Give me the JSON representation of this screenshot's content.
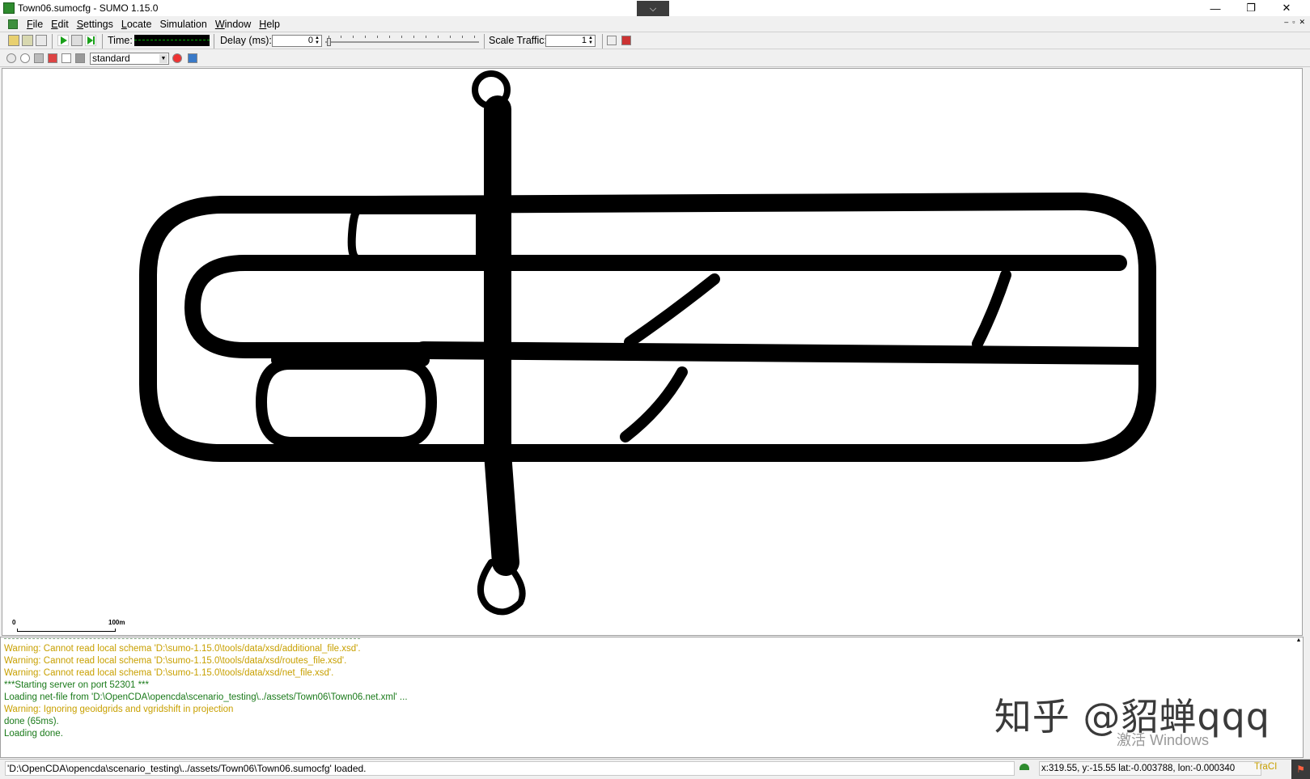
{
  "window": {
    "title": "Town06.sumocfg - SUMO 1.15.0",
    "collapse_glyph": "⌵",
    "minimize_glyph": "—",
    "restore_glyph": "❐",
    "close_glyph": "✕"
  },
  "menu": {
    "items": [
      {
        "u": "F",
        "rest": "ile"
      },
      {
        "u": "E",
        "rest": "dit"
      },
      {
        "u": "S",
        "rest": "ettings"
      },
      {
        "u": "L",
        "rest": "ocate"
      },
      {
        "u": "S",
        "rest": "imulation"
      },
      {
        "u": "W",
        "rest": "indow"
      },
      {
        "u": "H",
        "rest": "elp"
      }
    ],
    "mdi_buttons": [
      "–",
      "▫",
      "✕"
    ]
  },
  "toolbar": {
    "time_label": "Time:",
    "delay_label": "Delay (ms):",
    "delay_value": "0",
    "scale_traffic_label": "Scale Traffic:",
    "scale_traffic_value": "1",
    "delay_slider_value": 0
  },
  "view": {
    "scheme": "standard"
  },
  "canvas": {
    "scale_zero": "0",
    "scale_label": "100m"
  },
  "log": {
    "lines": [
      {
        "type": "warning",
        "text": "Warning: Cannot read local schema 'D:\\sumo-1.15.0\\tools/data/xsd/additional_file.xsd'."
      },
      {
        "type": "warning",
        "text": "Warning: Cannot read local schema 'D:\\sumo-1.15.0\\tools/data/xsd/routes_file.xsd'."
      },
      {
        "type": "warning",
        "text": "Warning: Cannot read local schema 'D:\\sumo-1.15.0\\tools/data/xsd/net_file.xsd'."
      },
      {
        "type": "info",
        "text": "***Starting server on port 52301 ***"
      },
      {
        "type": "info",
        "text": "Loading net-file from 'D:\\OpenCDA\\opencda\\scenario_testing\\../assets/Town06\\Town06.net.xml' ..."
      },
      {
        "type": "warning",
        "text": "Warning: Ignoring geoidgrids and vgridshift in projection"
      },
      {
        "type": "info",
        "text": "done (65ms)."
      },
      {
        "type": "info",
        "text": "Loading done."
      }
    ],
    "watermark": "知乎 @貂蝉qqq",
    "activate_text": "激活 Windows"
  },
  "status": {
    "message": "'D:\\OpenCDA\\opencda\\scenario_testing\\../assets/Town06\\Town06.sumocfg' loaded.",
    "coords": "x:319.55, y:-15.55  lat:-0.003788, lon:-0.000340",
    "traci": "TraCI"
  }
}
